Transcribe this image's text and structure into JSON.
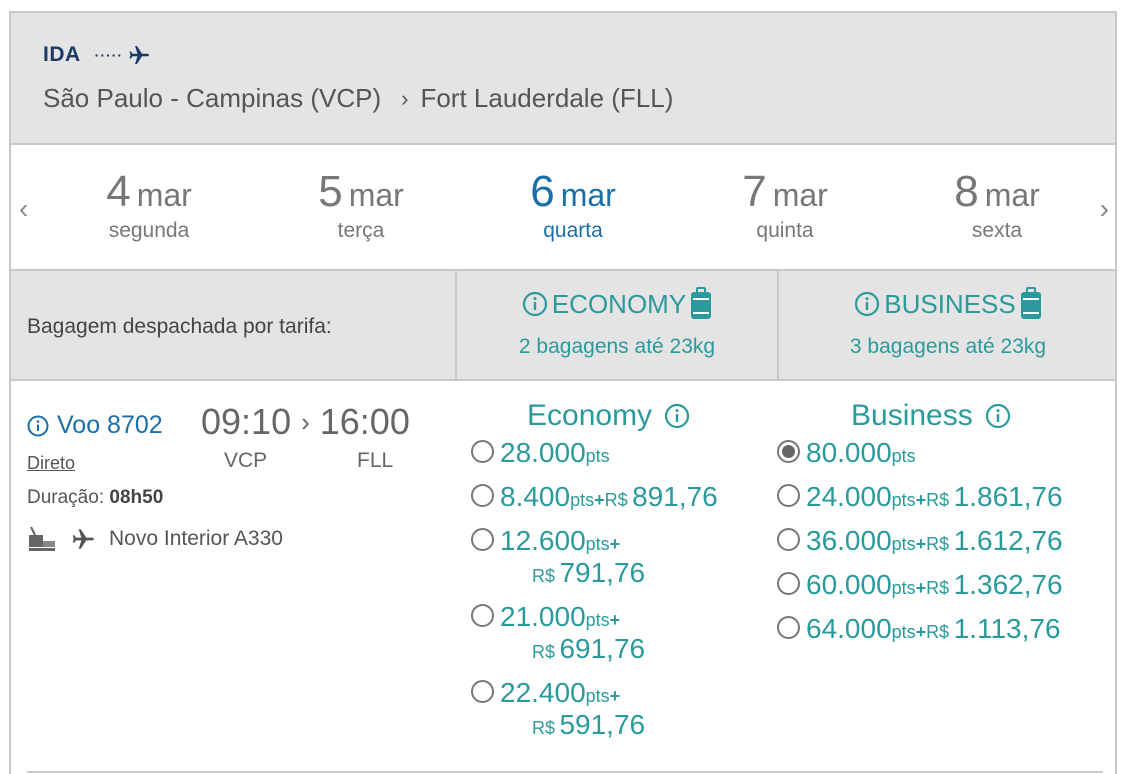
{
  "header": {
    "direction": "IDA",
    "dots": "·····",
    "origin": "São Paulo - Campinas (VCP)",
    "destination": "Fort Lauderdale (FLL)"
  },
  "dates": [
    {
      "num": "4",
      "mon": "mar",
      "weekday": "segunda",
      "active": false
    },
    {
      "num": "5",
      "mon": "mar",
      "weekday": "terça",
      "active": false
    },
    {
      "num": "6",
      "mon": "mar",
      "weekday": "quarta",
      "active": true
    },
    {
      "num": "7",
      "mon": "mar",
      "weekday": "quinta",
      "active": false
    },
    {
      "num": "8",
      "mon": "mar",
      "weekday": "sexta",
      "active": false
    }
  ],
  "nav": {
    "prev": "‹",
    "next": "›"
  },
  "baggage": {
    "label": "Bagagem despachada por tarifa:",
    "economy": {
      "title": "ECONOMY",
      "desc": "2 bagagens até 23kg"
    },
    "business": {
      "title": "BUSINESS",
      "desc": "3 bagagens até 23kg"
    }
  },
  "flight": {
    "number": "Voo 8702",
    "depart": "09:10",
    "arrive": "16:00",
    "from": "VCP",
    "to": "FLL",
    "type": "Direto",
    "duration_label": "Duração:",
    "duration": "08h50",
    "aircraft": "Novo Interior A330"
  },
  "fares": {
    "economy": {
      "title": "Economy",
      "options": [
        {
          "points": "28.000",
          "pts": "pts",
          "plus": "",
          "currency": "",
          "cash": "",
          "wrap": false,
          "selected": false
        },
        {
          "points": "8.400",
          "pts": "pts",
          "plus": "+",
          "currency": "R$",
          "cash": "891,76",
          "wrap": false,
          "selected": false
        },
        {
          "points": "12.600",
          "pts": "pts",
          "plus": "+",
          "currency": "R$",
          "cash": "791,76",
          "wrap": true,
          "selected": false
        },
        {
          "points": "21.000",
          "pts": "pts",
          "plus": "+",
          "currency": "R$",
          "cash": "691,76",
          "wrap": true,
          "selected": false
        },
        {
          "points": "22.400",
          "pts": "pts",
          "plus": "+",
          "currency": "R$",
          "cash": "591,76",
          "wrap": true,
          "selected": false
        }
      ]
    },
    "business": {
      "title": "Business",
      "options": [
        {
          "points": "80.000",
          "pts": "pts",
          "plus": "",
          "currency": "",
          "cash": "",
          "wrap": false,
          "selected": true
        },
        {
          "points": "24.000",
          "pts": "pts",
          "plus": "+",
          "currency": "R$",
          "cash": "1.861,76",
          "wrap": false,
          "selected": false
        },
        {
          "points": "36.000",
          "pts": "pts",
          "plus": "+",
          "currency": "R$",
          "cash": "1.612,76",
          "wrap": false,
          "selected": false
        },
        {
          "points": "60.000",
          "pts": "pts",
          "plus": "+",
          "currency": "R$",
          "cash": "1.362,76",
          "wrap": false,
          "selected": false
        },
        {
          "points": "64.000",
          "pts": "pts",
          "plus": "+",
          "currency": "R$",
          "cash": "1.113,76",
          "wrap": false,
          "selected": false
        }
      ]
    }
  },
  "colors": {
    "teal": "#2a9a9c",
    "blue": "#1a6fa8",
    "navy": "#1b3a66",
    "grey_bg": "#e4e4e4"
  },
  "icons": {
    "plane": "airplane-icon",
    "info": "info-icon",
    "suitcase": "suitcase-icon",
    "meal": "meal-icon"
  }
}
